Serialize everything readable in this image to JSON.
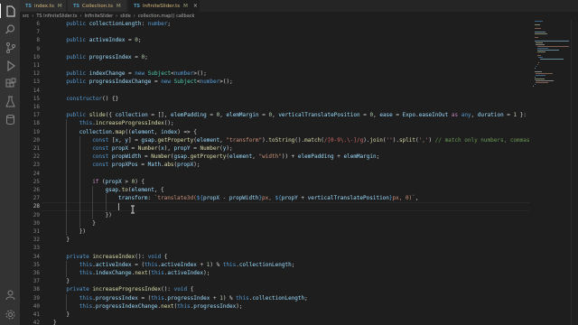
{
  "activity_bar": {
    "icons": [
      "files-icon",
      "search-icon",
      "source-control-icon",
      "run-debug-icon",
      "extensions-icon",
      "testing-icon",
      "database-icon",
      "account-icon",
      "settings-gear-icon"
    ]
  },
  "tabs": [
    {
      "name": "index.ts",
      "status": "M",
      "lang": "TS"
    },
    {
      "name": "Collection.ts",
      "status": "M",
      "lang": "TS"
    },
    {
      "name": "InfiniteSlider.ts",
      "status": "M",
      "lang": "TS",
      "active": true,
      "close": "×"
    }
  ],
  "breadcrumb": [
    "src",
    "›",
    "TS InfiniteSlider.ts",
    "›",
    "InfiniteSlider",
    "›",
    "slide",
    "›",
    "collection.map() callback"
  ],
  "code_lines": [
    {
      "num": "6",
      "indent": 1,
      "html": "<span class='k'>public</span> <span class='v'>collectionLength</span>: <span class='k'>number</span>;"
    },
    {
      "num": "7",
      "indent": 1,
      "html": ""
    },
    {
      "num": "8",
      "indent": 1,
      "html": "<span class='k'>public</span> <span class='v'>activeIndex</span> = <span class='n'>0</span>;"
    },
    {
      "num": "9",
      "indent": 1,
      "html": ""
    },
    {
      "num": "10",
      "indent": 1,
      "html": "<span class='k'>public</span> <span class='v'>progressIndex</span> = <span class='n'>0</span>;"
    },
    {
      "num": "11",
      "indent": 1,
      "html": ""
    },
    {
      "num": "12",
      "indent": 1,
      "html": "<span class='k'>public</span> <span class='v'>indexChange</span> = <span class='k'>new</span> <span class='t'>Subject</span>&lt;<span class='k'>number</span>&gt;();"
    },
    {
      "num": "13",
      "indent": 1,
      "html": "<span class='k'>public</span> <span class='v'>progressIndexChange</span> = <span class='k'>new</span> <span class='t'>Subject</span>&lt;<span class='k'>number</span>&gt;();"
    },
    {
      "num": "14",
      "indent": 1,
      "html": ""
    },
    {
      "num": "15",
      "indent": 1,
      "html": "<span class='k'>constructor</span>() {}"
    },
    {
      "num": "16",
      "indent": 1,
      "html": ""
    },
    {
      "num": "17",
      "indent": 1,
      "html": "<span class='k'>public</span> <span class='f'>slide</span>({ <span class='v'>collection</span> = [], <span class='v'>elemPadding</span> = <span class='n'>0</span>, <span class='v'>elemMargin</span> = <span class='n'>0</span>, <span class='v'>verticalTranslatePosition</span> = <span class='n'>0</span>, <span class='v'>ease</span> = <span class='v'>Expo</span>.<span class='v'>easeInOut</span> <span class='kc'>as</span> <span class='k'>any</span>, <span class='v'>duration</span> = <span class='n'>1</span> }:"
    },
    {
      "num": "18",
      "indent": 2,
      "html": "<span class='k'>this</span>.<span class='f'>increaseProgressIndex</span>();"
    },
    {
      "num": "19",
      "indent": 2,
      "html": "<span class='v'>collection</span>.<span class='f'>map</span>((<span class='v'>element</span>, <span class='v'>index</span>) =&gt; {"
    },
    {
      "num": "20",
      "indent": 3,
      "html": "<span class='k'>const</span> [<span class='v'>x</span>, <span class='v'>y</span>] = <span class='v'>gsap</span>.<span class='f'>getProperty</span>(<span class='v'>element</span>, <span class='s'>\"transform\"</span>).<span class='f'>toString</span>().<span class='f'>match</span>(<span class='r'>/[0-9\\.\\-]/g</span>).<span class='f'>join</span>(<span class='s'>''</span>).<span class='f'>split</span>(<span class='s'>','</span>) <span class='c'>// match only numbers, commas</span>"
    },
    {
      "num": "21",
      "indent": 3,
      "html": "<span class='k'>const</span> <span class='v'>propX</span> = <span class='f'>Number</span>(<span class='v'>x</span>), <span class='v'>propY</span> = <span class='f'>Number</span>(<span class='v'>y</span>);"
    },
    {
      "num": "22",
      "indent": 3,
      "html": "<span class='k'>const</span> <span class='v'>propWidth</span> = <span class='f'>Number</span>(<span class='v'>gsap</span>.<span class='f'>getProperty</span>(<span class='v'>element</span>, <span class='s'>\"width\"</span>)) + <span class='v'>elemPadding</span> + <span class='v'>elemMargin</span>;"
    },
    {
      "num": "23",
      "indent": 3,
      "html": "<span class='k'>const</span> <span class='v'>propXPos</span> = <span class='v'>Math</span>.<span class='f'>abs</span>(<span class='v'>propX</span>);"
    },
    {
      "num": "24",
      "indent": 3,
      "html": ""
    },
    {
      "num": "25",
      "indent": 3,
      "html": "<span class='kc'>if</span> (<span class='v'>propX</span> &gt; <span class='n'>0</span>) {"
    },
    {
      "num": "26",
      "indent": 4,
      "html": "<span class='v'>gsap</span>.<span class='f'>to</span>(<span class='v'>element</span>, {"
    },
    {
      "num": "27",
      "indent": 5,
      "html": "<span class='v'>transform</span>: <span class='s'>`translate3d(</span><span class='k'>${</span><span class='v'>propX</span> - <span class='v'>propWidth</span><span class='k'>}</span><span class='s'>px, </span><span class='k'>${</span><span class='v'>propY</span> + <span class='v'>verticalTranslatePosition</span><span class='k'>}</span><span class='s'>px, 0)`</span>,"
    },
    {
      "num": "28",
      "indent": 5,
      "html": "",
      "current": true
    },
    {
      "num": "29",
      "indent": 4,
      "html": "})"
    },
    {
      "num": "30",
      "indent": 3,
      "html": "}"
    },
    {
      "num": "31",
      "indent": 2,
      "html": "})"
    },
    {
      "num": "32",
      "indent": 1,
      "html": "}"
    },
    {
      "num": "33",
      "indent": 1,
      "html": ""
    },
    {
      "num": "34",
      "indent": 1,
      "html": "<span class='k'>private</span> <span class='f'>increaseIndex</span>(): <span class='k'>void</span> {"
    },
    {
      "num": "35",
      "indent": 2,
      "html": "<span class='k'>this</span>.<span class='v'>activeIndex</span> = (<span class='k'>this</span>.<span class='v'>activeIndex</span> + <span class='n'>1</span>) % <span class='k'>this</span>.<span class='v'>collectionLength</span>;"
    },
    {
      "num": "36",
      "indent": 2,
      "html": "<span class='k'>this</span>.<span class='v'>indexChange</span>.<span class='f'>next</span>(<span class='k'>this</span>.<span class='v'>activeIndex</span>);"
    },
    {
      "num": "37",
      "indent": 1,
      "html": "}"
    },
    {
      "num": "38",
      "indent": 1,
      "html": "<span class='k'>private</span> <span class='f'>increaseProgressIndex</span>(): <span class='k'>void</span> {"
    },
    {
      "num": "39",
      "indent": 2,
      "html": "<span class='k'>this</span>.<span class='v'>progressIndex</span> = (<span class='k'>this</span>.<span class='v'>progressIndex</span> + <span class='n'>1</span>) % <span class='k'>this</span>.<span class='v'>collectionLength</span>;"
    },
    {
      "num": "40",
      "indent": 2,
      "html": "<span class='k'>this</span>.<span class='v'>progressIndexChange</span>.<span class='f'>next</span>(<span class='k'>this</span>.<span class='v'>progressIndex</span>);"
    },
    {
      "num": "41",
      "indent": 1,
      "html": "}"
    },
    {
      "num": "42",
      "indent": 0,
      "html": "}"
    },
    {
      "num": "43",
      "indent": 0,
      "html": ""
    }
  ],
  "colors": {
    "editor_bg": "#1e1e1e",
    "keyword": "#569cd6",
    "function": "#dcdcaa",
    "variable": "#9cdcfe",
    "string": "#ce9178",
    "comment": "#6a9955",
    "modified": "#d7ba7d"
  }
}
